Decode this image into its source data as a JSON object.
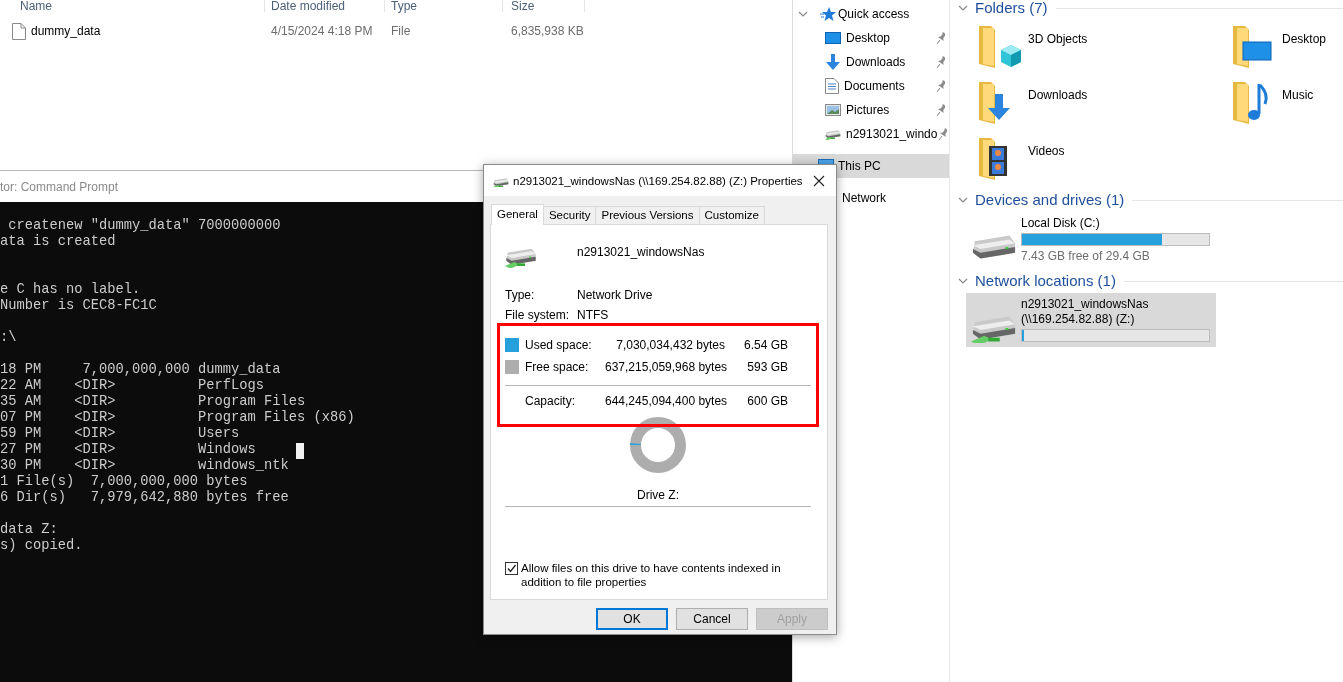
{
  "file_list": {
    "columns": [
      "Name",
      "Date modified",
      "Type",
      "Size"
    ],
    "rows": [
      {
        "name": "dummy_data",
        "date_modified": "4/15/2024 4:18 PM",
        "type": "File",
        "size": "6,835,938 KB"
      }
    ]
  },
  "command_prompt": {
    "title": "tor: Command Prompt",
    "output": " createnew \"dummy_data\" 7000000000\nata is created\n\n\ne C has no label.\nNumber is CEC8-FC1C\n\n:\\\n\n18 PM     7,000,000,000 dummy_data\n22 AM    <DIR>          PerfLogs\n35 AM    <DIR>          Program Files\n07 PM    <DIR>          Program Files (x86)\n59 PM    <DIR>          Users\n27 PM    <DIR>          Windows\n30 PM    <DIR>          windows_ntk\n1 File(s)  7,000,000,000 bytes\n6 Dir(s)   7,979,642,880 bytes free\n\ndata Z:\ns) copied.",
    "cursor": true
  },
  "navigation": {
    "items": [
      {
        "label": "Quick access",
        "kind": "quick_access",
        "expanded": true,
        "selected": false,
        "children": [
          {
            "label": "Desktop",
            "kind": "desktop",
            "pinned": true,
            "selected": false
          },
          {
            "label": "Downloads",
            "kind": "downloads",
            "pinned": true,
            "selected": false
          },
          {
            "label": "Documents",
            "kind": "documents",
            "pinned": true,
            "selected": false
          },
          {
            "label": "Pictures",
            "kind": "pictures",
            "pinned": true,
            "selected": false
          },
          {
            "label": "n2913021_windo",
            "kind": "network_drive",
            "pinned": true,
            "selected": false
          }
        ]
      },
      {
        "label": "This PC",
        "kind": "pc",
        "selected": true
      },
      {
        "label": "Network",
        "kind": "network",
        "selected": false
      }
    ]
  },
  "content": {
    "sections": [
      {
        "title": "Folders (7)",
        "kind": "folders",
        "expanded": true,
        "items": [
          {
            "label": "3D Objects",
            "kind": "objects3d"
          },
          {
            "label": "Desktop",
            "kind": "desktop"
          },
          {
            "label": "Downloads",
            "kind": "downloads"
          },
          {
            "label": "Music",
            "kind": "music"
          },
          {
            "label": "Videos",
            "kind": "videos"
          }
        ]
      },
      {
        "title": "Devices and drives (1)",
        "kind": "drives",
        "expanded": true,
        "items": [
          {
            "name": "Local Disk (C:)",
            "kind": "local",
            "level": 0.747,
            "free_text": "7.43 GB free of 29.4 GB",
            "selected": false
          }
        ]
      },
      {
        "title": "Network locations (1)",
        "kind": "drives",
        "expanded": true,
        "items": [
          {
            "name": "n2913021_windowsNas",
            "address": "(\\\\169.254.82.88) (Z:)",
            "kind": "network",
            "level": 0.011,
            "selected": true
          }
        ]
      }
    ]
  },
  "dialog": {
    "title": "n2913021_windowsNas (\\\\169.254.82.88) (Z:) Properties",
    "tabs": [
      {
        "label": "General",
        "selected": true
      },
      {
        "label": "Security",
        "selected": false
      },
      {
        "label": "Previous Versions",
        "selected": false
      },
      {
        "label": "Customize",
        "selected": false
      }
    ],
    "drive_name": "n2913021_windowsNas",
    "properties": [
      {
        "label": "Type:",
        "value": "Network Drive"
      },
      {
        "label": "File system:",
        "value": "NTFS"
      }
    ],
    "space": {
      "highlighted": true,
      "level": 0.011,
      "rows": [
        {
          "label": "Used space:",
          "bytes": "7,030,034,432 bytes",
          "size": "6.54 GB",
          "color": "#26a0da"
        },
        {
          "label": "Free space:",
          "bytes": "637,215,059,968 bytes",
          "size": "593 GB",
          "color": "#adadad"
        }
      ],
      "capacity": {
        "label": "Capacity:",
        "bytes": "644,245,094,400 bytes",
        "size": "600 GB"
      }
    },
    "drive_label": "Drive Z:",
    "index_checkbox": {
      "label": "Allow files on this drive to have contents indexed in addition to file properties",
      "checked": true
    },
    "buttons": [
      {
        "label": "OK",
        "default": true,
        "disabled": false
      },
      {
        "label": "Cancel",
        "default": false,
        "disabled": false
      },
      {
        "label": "Apply",
        "default": false,
        "disabled": true
      }
    ]
  }
}
